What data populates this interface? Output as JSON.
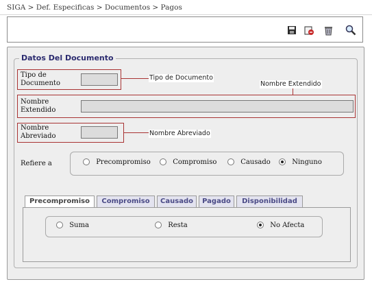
{
  "breadcrumb": "SIGA > Def. Especificas > Documentos > Pagos",
  "toolbar": {
    "icons": [
      "save-icon",
      "cancel-icon",
      "delete-icon",
      "search-icon"
    ]
  },
  "section": {
    "legend": "Datos Del Documento"
  },
  "fields": {
    "tipo_label_line1": "Tipo de",
    "tipo_label_line2": "Documento",
    "nombre_ext_line1": "Nombre",
    "nombre_ext_line2": "Extendido",
    "nombre_abr_line1": "Nombre",
    "nombre_abr_line2": "Abreviado",
    "tipo_value": "",
    "nombre_ext_value": "",
    "nombre_abr_value": ""
  },
  "annotations": {
    "tipo": "Tipo de Documento",
    "extendido": "Nombre Extendido",
    "abreviado": "Nombre Abreviado"
  },
  "refiere": {
    "label": "Refiere a",
    "options": [
      "Precompromiso",
      "Compromiso",
      "Causado",
      "Ninguno"
    ],
    "selected": "Ninguno"
  },
  "tabs": [
    "Precompromiso",
    "Compromiso",
    "Causado",
    "Pagado",
    "Disponibilidad"
  ],
  "active_tab": "Precompromiso",
  "panel": {
    "options": [
      "Suma",
      "Resta",
      "No Afecta"
    ],
    "selected": "No Afecta"
  }
}
